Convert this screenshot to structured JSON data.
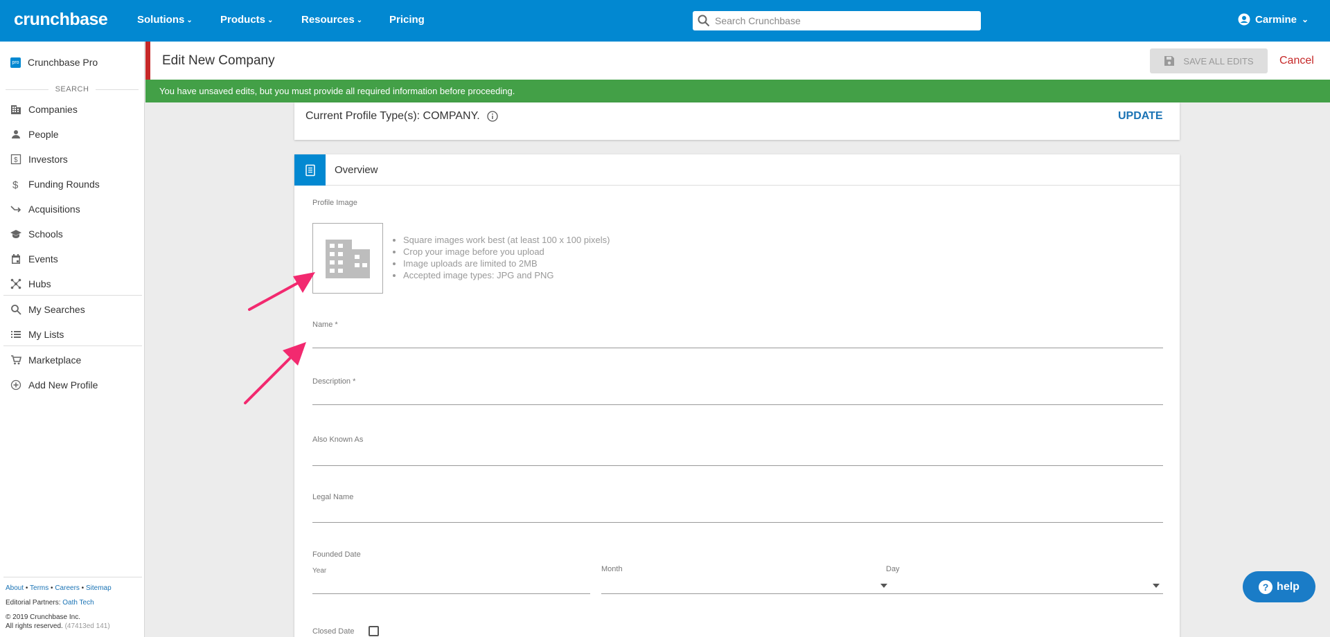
{
  "header": {
    "logo": "crunchbase",
    "nav": [
      "Solutions",
      "Products",
      "Resources",
      "Pricing"
    ],
    "search_placeholder": "Search Crunchbase",
    "user_name": "Carmine"
  },
  "sidebar": {
    "pro_badge": "pro",
    "pro_label": "Crunchbase Pro",
    "search_section": "SEARCH",
    "items": [
      {
        "label": "Companies",
        "icon": "building-icon"
      },
      {
        "label": "People",
        "icon": "person-icon"
      },
      {
        "label": "Investors",
        "icon": "investor-icon"
      },
      {
        "label": "Funding Rounds",
        "icon": "dollar-icon"
      },
      {
        "label": "Acquisitions",
        "icon": "merge-icon"
      },
      {
        "label": "Schools",
        "icon": "school-icon"
      },
      {
        "label": "Events",
        "icon": "calendar-icon"
      },
      {
        "label": "Hubs",
        "icon": "hub-icon"
      }
    ],
    "my_items": [
      {
        "label": "My Searches",
        "icon": "search-icon"
      },
      {
        "label": "My Lists",
        "icon": "list-icon"
      }
    ],
    "extra_items": [
      {
        "label": "Marketplace",
        "icon": "cart-icon"
      },
      {
        "label": "Add New Profile",
        "icon": "add-circle-icon"
      }
    ],
    "footer": {
      "links": [
        "About",
        "Terms",
        "Careers",
        "Sitemap"
      ],
      "partners_label": "Editorial Partners:",
      "partners_link": "Oath Tech",
      "copyright": "© 2019 Crunchbase Inc.",
      "rights": "All rights reserved.",
      "build": "(47413ed 141)"
    }
  },
  "editbar": {
    "title": "Edit New Company",
    "save_label": "SAVE ALL EDITS",
    "cancel_label": "Cancel"
  },
  "banner": {
    "message": "You have unsaved edits, but you must provide all required information before proceeding."
  },
  "profile_type": {
    "text": "Current Profile Type(s): COMPANY.",
    "update_label": "UPDATE"
  },
  "overview": {
    "title": "Overview",
    "profile_image_label": "Profile Image",
    "tips": [
      "Square images work best (at least 100 x 100 pixels)",
      "Crop your image before you upload",
      "Image uploads are limited to 2MB",
      "Accepted image types: JPG and PNG"
    ],
    "name_label": "Name *",
    "description_label": "Description *",
    "aka_label": "Also Known As",
    "legal_name_label": "Legal Name",
    "founded_label": "Founded Date",
    "year_label": "Year",
    "month_label": "Month",
    "day_label": "Day",
    "closed_label": "Closed Date"
  },
  "help": {
    "label": "help"
  },
  "colors": {
    "topbar": "#0288d1",
    "banner": "#43a047",
    "accent_red": "#c62828",
    "link_blue": "#1a73b5"
  }
}
